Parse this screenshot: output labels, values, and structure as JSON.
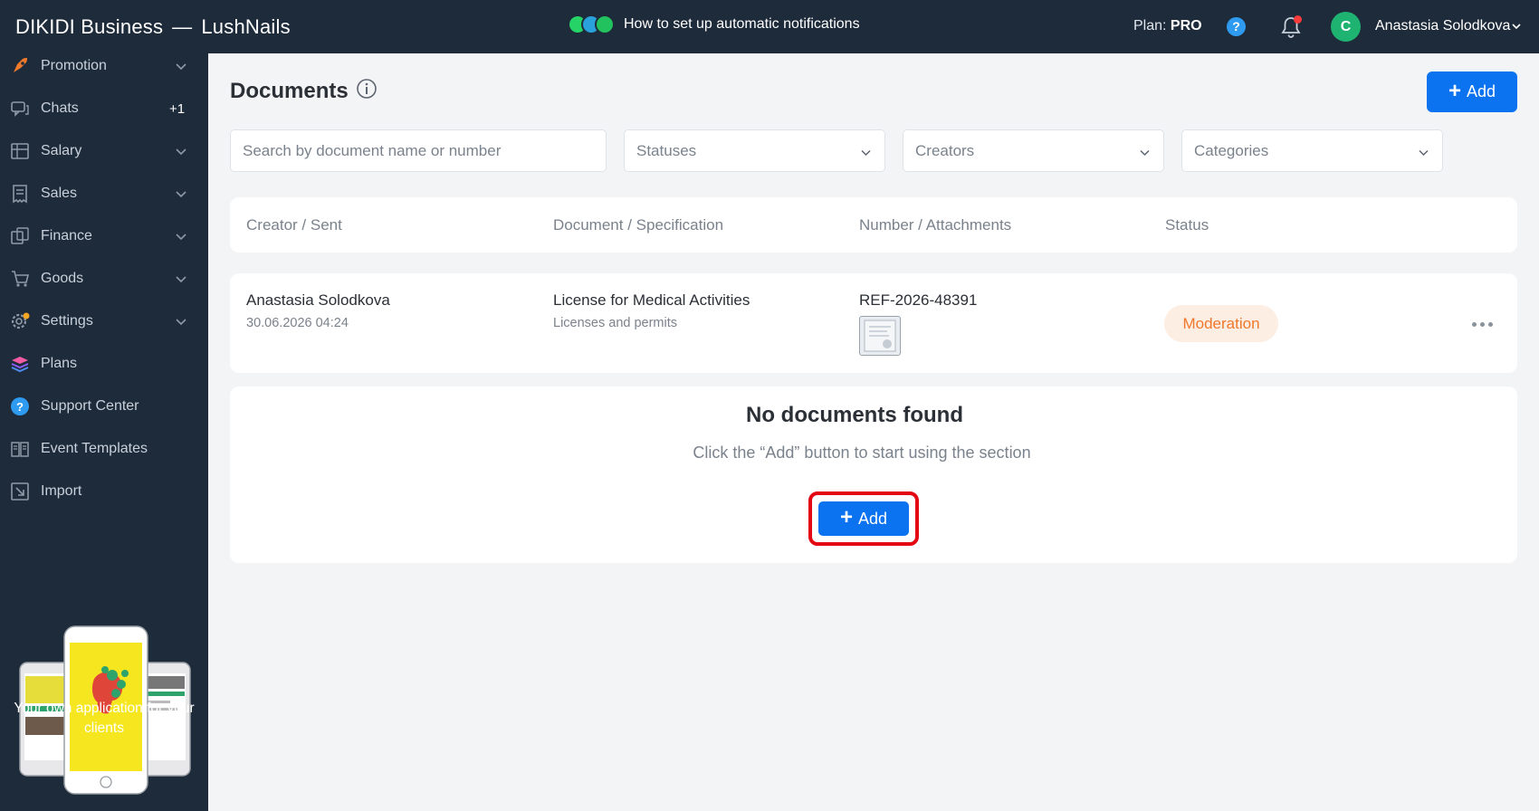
{
  "app": {
    "brand": "DIKIDI Business",
    "separator": "—",
    "company": "LushNails"
  },
  "header": {
    "notification_link": "How to set up automatic notifications",
    "plan_label": "Plan:",
    "plan_value": "PRO",
    "help_icon": "?",
    "user_initial": "C",
    "user_name": "Anastasia Solodkova"
  },
  "sidebar": {
    "items": [
      {
        "label": "Promotion",
        "icon": "rocket-icon",
        "chevron": true
      },
      {
        "label": "Chats",
        "icon": "chat-icon",
        "badge": "+1"
      },
      {
        "label": "Salary",
        "icon": "salary-icon",
        "chevron": true
      },
      {
        "label": "Sales",
        "icon": "receipt-icon",
        "chevron": true
      },
      {
        "label": "Finance",
        "icon": "coins-icon",
        "chevron": true
      },
      {
        "label": "Goods",
        "icon": "cart-icon",
        "chevron": true
      },
      {
        "label": "Settings",
        "icon": "gear-icon",
        "chevron": true
      },
      {
        "label": "Plans",
        "icon": "layers-icon"
      },
      {
        "label": "Support Center",
        "icon": "help-icon"
      },
      {
        "label": "Event Templates",
        "icon": "book-icon"
      },
      {
        "label": "Import",
        "icon": "import-icon"
      }
    ],
    "promo_text": "Your own application for your clients"
  },
  "main": {
    "title": "Documents",
    "add_label": "Add",
    "search_placeholder": "Search by document name or number",
    "filters": {
      "statuses": "Statuses",
      "creators": "Creators",
      "categories": "Categories"
    },
    "columns": [
      "Creator / Sent",
      "Document / Specification",
      "Number / Attachments",
      "Status"
    ],
    "rows": [
      {
        "creator": "Anastasia Solodkova",
        "sent": "30.06.2026 04:24",
        "document": "License for Medical Activities",
        "specification": "Licenses and permits",
        "number": "REF-2026-48391",
        "status": "Moderation"
      }
    ],
    "empty_title": "No documents found",
    "empty_subtitle": "Click the “Add” button to start using the section"
  },
  "colors": {
    "accent": "#0b73f0",
    "sidebar": "#1e2b3a",
    "status_moderation": "#f0772b",
    "highlight": "#e30613"
  }
}
